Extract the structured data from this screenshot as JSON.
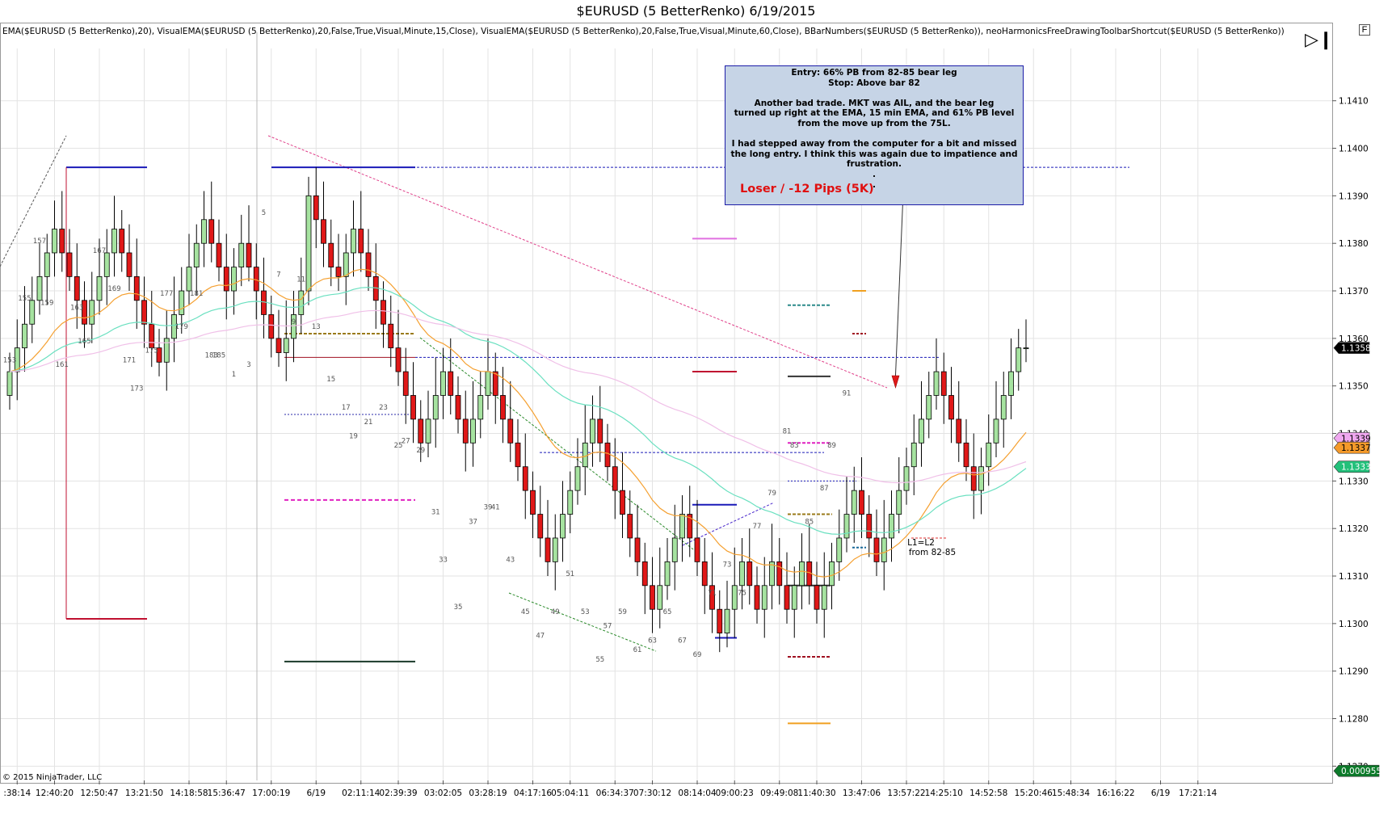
{
  "window": {
    "title": "$EURUSD (5 BetterRenko)  6/19/2015"
  },
  "indicator_line": "EMA($EURUSD (5 BetterRenko),20), VisualEMA($EURUSD (5 BetterRenko),20,False,True,Visual,Minute,15,Close), VisualEMA($EURUSD (5 BetterRenko),20,False,True,Visual,Minute,60,Close), BBarNumbers($EURUSD (5 BetterRenko)), neoHarmonicsFreeDrawingToolbarShortcut($EURUSD (5 BetterRenko))",
  "note": {
    "lines": [
      "Entry: 66% PB from 82-85 bear leg",
      "Stop: Above bar 82",
      "",
      "Another bad trade.  MKT was AIL, and the bear leg",
      "turned up right at the EMA, 15 min EMA, and 61% PB level",
      "from the move up from the 75L.",
      "",
      "I had stepped away from the computer for a bit and missed",
      "the long entry.  I think this was again due to impatience and",
      "frustration.",
      ".",
      "."
    ],
    "result": "Loser / -12 Pips (5K)"
  },
  "copyright": "© 2015 NinjaTrader, LLC",
  "icons": {
    "scroll": "scroll-end-icon",
    "f": "F"
  },
  "colors": {
    "up": "#a6e3a0",
    "down": "#e01818",
    "grid": "#e3e3e3"
  },
  "chart_data": {
    "type": "candlestick",
    "instrument": "$EURUSD (5 BetterRenko)",
    "ylim": [
      1.1267,
      1.1421
    ],
    "yticks": [
      "1.1270",
      "1.1280",
      "1.1290",
      "1.1300",
      "1.1310",
      "1.1320",
      "1.1330",
      "1.1340",
      "1.1350",
      "1.1360",
      "1.1370",
      "1.1380",
      "1.1390",
      "1.1400",
      "1.1410"
    ],
    "xticks": [
      {
        "label": ":38:14",
        "i": 1
      },
      {
        "label": "12:40:20",
        "i": 6
      },
      {
        "label": "12:50:47",
        "i": 12
      },
      {
        "label": "13:21:50",
        "i": 18
      },
      {
        "label": "14:18:58",
        "i": 24
      },
      {
        "label": "15:36:47",
        "i": 29
      },
      {
        "label": "17:00:19",
        "i": 35
      },
      {
        "label": "6/19",
        "i": 41
      },
      {
        "label": "02:11:14",
        "i": 47
      },
      {
        "label": "02:39:39",
        "i": 52
      },
      {
        "label": "03:02:05",
        "i": 58
      },
      {
        "label": "03:28:19",
        "i": 64
      },
      {
        "label": "04:17:16",
        "i": 70
      },
      {
        "label": "05:04:11",
        "i": 75
      },
      {
        "label": "06:34:37",
        "i": 81
      },
      {
        "label": "07:30:12",
        "i": 86
      },
      {
        "label": "08:14:04",
        "i": 92
      },
      {
        "label": "09:00:23",
        "i": 97
      },
      {
        "label": "09:49:08",
        "i": 103
      },
      {
        "label": "11:40:30",
        "i": 108
      },
      {
        "label": "13:47:06",
        "i": 114
      },
      {
        "label": "13:57:22",
        "i": 120
      },
      {
        "label": "14:25:10",
        "i": 125
      },
      {
        "label": "14:52:58",
        "i": 131
      },
      {
        "label": "15:20:46",
        "i": 137
      },
      {
        "label": "15:48:34",
        "i": 142
      },
      {
        "label": "16:16:22",
        "i": 148
      },
      {
        "label": "6/19",
        "i": 154
      },
      {
        "label": "17:21:14",
        "i": 159
      }
    ],
    "closes": [
      1.1353,
      1.1358,
      1.1363,
      1.1368,
      1.1373,
      1.1378,
      1.1383,
      1.1378,
      1.1373,
      1.1368,
      1.1363,
      1.1368,
      1.1373,
      1.1378,
      1.1383,
      1.1378,
      1.1373,
      1.1368,
      1.1363,
      1.1358,
      1.1355,
      1.136,
      1.1365,
      1.137,
      1.1375,
      1.138,
      1.1385,
      1.138,
      1.1375,
      1.137,
      1.1375,
      1.138,
      1.1375,
      1.137,
      1.1365,
      1.136,
      1.1357,
      1.136,
      1.1365,
      1.137,
      1.139,
      1.1385,
      1.138,
      1.1375,
      1.1373,
      1.1378,
      1.1383,
      1.1378,
      1.1373,
      1.1368,
      1.1363,
      1.1358,
      1.1353,
      1.1348,
      1.1343,
      1.1338,
      1.1343,
      1.1348,
      1.1353,
      1.1348,
      1.1343,
      1.1338,
      1.1343,
      1.1348,
      1.1353,
      1.1348,
      1.1343,
      1.1338,
      1.1333,
      1.1328,
      1.1323,
      1.1318,
      1.1313,
      1.1318,
      1.1323,
      1.1328,
      1.1333,
      1.1338,
      1.1343,
      1.1338,
      1.1333,
      1.1328,
      1.1323,
      1.1318,
      1.1313,
      1.1308,
      1.1303,
      1.1308,
      1.1313,
      1.1318,
      1.1323,
      1.1318,
      1.1313,
      1.1308,
      1.1303,
      1.1298,
      1.1303,
      1.1308,
      1.1313,
      1.1308,
      1.1303,
      1.1308,
      1.1313,
      1.1308,
      1.1303,
      1.1308,
      1.1313,
      1.1308,
      1.1303,
      1.1308,
      1.1313,
      1.1318,
      1.1323,
      1.1328,
      1.1323,
      1.1318,
      1.1313,
      1.1318,
      1.1323,
      1.1328,
      1.1333,
      1.1338,
      1.1343,
      1.1348,
      1.1353,
      1.1348,
      1.1343,
      1.1338,
      1.1333,
      1.1328,
      1.1333,
      1.1338,
      1.1343,
      1.1348,
      1.1353,
      1.1358,
      1.1358
    ],
    "first_open": 1.1348,
    "bar_labels": [
      {
        "text": "153",
        "i": 0,
        "p": 1.1355
      },
      {
        "text": "155",
        "i": 2,
        "p": 1.1368
      },
      {
        "text": "157",
        "i": 4,
        "p": 1.138
      },
      {
        "text": "159",
        "i": 5,
        "p": 1.1367
      },
      {
        "text": "161",
        "i": 7,
        "p": 1.1354
      },
      {
        "text": "163",
        "i": 9,
        "p": 1.1366
      },
      {
        "text": "165",
        "i": 10,
        "p": 1.1359
      },
      {
        "text": "167",
        "i": 12,
        "p": 1.1378
      },
      {
        "text": "169",
        "i": 14,
        "p": 1.137
      },
      {
        "text": "171",
        "i": 16,
        "p": 1.1355
      },
      {
        "text": "173",
        "i": 17,
        "p": 1.1349
      },
      {
        "text": "175",
        "i": 19,
        "p": 1.1357
      },
      {
        "text": "177",
        "i": 21,
        "p": 1.1369
      },
      {
        "text": "179",
        "i": 23,
        "p": 1.1362
      },
      {
        "text": "181",
        "i": 25,
        "p": 1.1369
      },
      {
        "text": "183",
        "i": 27,
        "p": 1.1356
      },
      {
        "text": "185",
        "i": 28,
        "p": 1.1356
      },
      {
        "text": "1",
        "i": 30,
        "p": 1.1352
      },
      {
        "text": "3",
        "i": 32,
        "p": 1.1354
      },
      {
        "text": "5",
        "i": 34,
        "p": 1.1386
      },
      {
        "text": "7",
        "i": 36,
        "p": 1.1373
      },
      {
        "text": "9",
        "i": 38,
        "p": 1.1363
      },
      {
        "text": "11",
        "i": 39,
        "p": 1.1372
      },
      {
        "text": "13",
        "i": 41,
        "p": 1.1362
      },
      {
        "text": "15",
        "i": 43,
        "p": 1.1351
      },
      {
        "text": "17",
        "i": 45,
        "p": 1.1345
      },
      {
        "text": "19",
        "i": 46,
        "p": 1.1339
      },
      {
        "text": "21",
        "i": 48,
        "p": 1.1342
      },
      {
        "text": "23",
        "i": 50,
        "p": 1.1345
      },
      {
        "text": "25",
        "i": 52,
        "p": 1.1337
      },
      {
        "text": "27",
        "i": 53,
        "p": 1.1338
      },
      {
        "text": "29",
        "i": 55,
        "p": 1.1336
      },
      {
        "text": "31",
        "i": 57,
        "p": 1.1323
      },
      {
        "text": "33",
        "i": 58,
        "p": 1.1313
      },
      {
        "text": "35",
        "i": 60,
        "p": 1.1303
      },
      {
        "text": "37",
        "i": 62,
        "p": 1.1321
      },
      {
        "text": "39",
        "i": 64,
        "p": 1.1324
      },
      {
        "text": "41",
        "i": 65,
        "p": 1.1324
      },
      {
        "text": "43",
        "i": 67,
        "p": 1.1313
      },
      {
        "text": "45",
        "i": 69,
        "p": 1.1302
      },
      {
        "text": "47",
        "i": 71,
        "p": 1.1297
      },
      {
        "text": "49",
        "i": 73,
        "p": 1.1302
      },
      {
        "text": "51",
        "i": 75,
        "p": 1.131
      },
      {
        "text": "53",
        "i": 77,
        "p": 1.1302
      },
      {
        "text": "55",
        "i": 79,
        "p": 1.1292
      },
      {
        "text": "57",
        "i": 80,
        "p": 1.1299
      },
      {
        "text": "59",
        "i": 82,
        "p": 1.1302
      },
      {
        "text": "61",
        "i": 84,
        "p": 1.1294
      },
      {
        "text": "63",
        "i": 86,
        "p": 1.1296
      },
      {
        "text": "65",
        "i": 88,
        "p": 1.1302
      },
      {
        "text": "67",
        "i": 90,
        "p": 1.1296
      },
      {
        "text": "69",
        "i": 92,
        "p": 1.1293
      },
      {
        "text": "71",
        "i": 94,
        "p": 1.1306
      },
      {
        "text": "73",
        "i": 96,
        "p": 1.1312
      },
      {
        "text": "75",
        "i": 98,
        "p": 1.1306
      },
      {
        "text": "77",
        "i": 100,
        "p": 1.132
      },
      {
        "text": "79",
        "i": 102,
        "p": 1.1327
      },
      {
        "text": "81",
        "i": 104,
        "p": 1.134
      },
      {
        "text": "83",
        "i": 105,
        "p": 1.1337
      },
      {
        "text": "85",
        "i": 107,
        "p": 1.1321
      },
      {
        "text": "87",
        "i": 109,
        "p": 1.1328
      },
      {
        "text": "89",
        "i": 110,
        "p": 1.1337
      },
      {
        "text": "91",
        "i": 112,
        "p": 1.1348
      }
    ],
    "price_tags": [
      {
        "text": "1.1358",
        "price": 1.1358,
        "bg": "#000000",
        "fg": "#ffffff"
      },
      {
        "text": "1.1339",
        "price": 1.1339,
        "bg": "#f0a8f0",
        "fg": "#000000"
      },
      {
        "text": "1.1337",
        "price": 1.1337,
        "bg": "#f59a2a",
        "fg": "#000000"
      },
      {
        "text": "1.1333",
        "price": 1.1333,
        "bg": "#22c07a",
        "fg": "#ffffff"
      },
      {
        "text": "0.000955",
        "price": 1.1269,
        "bg": "#0c7a2a",
        "fg": "#ffffff"
      }
    ],
    "annotation": {
      "line1": "L1=L2",
      "line2": "from 82-85"
    }
  }
}
